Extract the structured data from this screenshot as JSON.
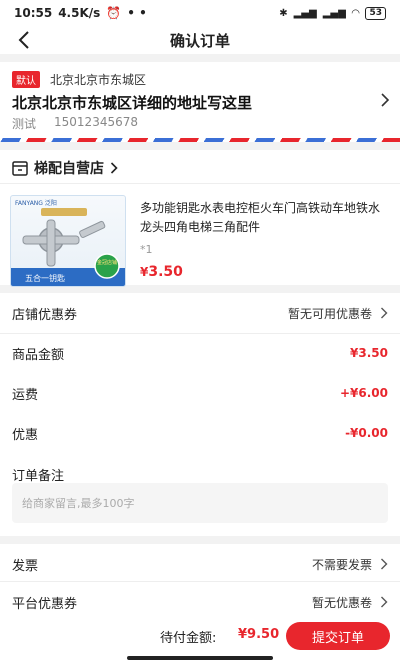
{
  "status": {
    "time": "10:55",
    "speed": "4.5K/s",
    "battery": "53"
  },
  "nav": {
    "title": "确认订单"
  },
  "address": {
    "default_tag": "默认",
    "region": "北京北京市东城区",
    "detail": "北京北京市东城区详细的地址写这里",
    "name": "测试",
    "phone": "15012345678"
  },
  "shop": {
    "name": "梯配自营店",
    "product": {
      "name": "多功能钥匙水表电控柜火车门高铁动车地铁水龙头四角电梯三角配件",
      "qty": "*1",
      "currency": "¥",
      "price": "3.50",
      "img_brand": "FANYANG 泛阳",
      "img_caption": "五合一钥匙",
      "img_badge": "金冠店铺"
    }
  },
  "rows": {
    "coupon": {
      "label": "店铺优惠券",
      "value": "暂无可用优惠卷"
    },
    "amount": {
      "label": "商品金额",
      "value": "¥3.50"
    },
    "shipping": {
      "label": "运费",
      "value": "+¥6.00"
    },
    "discount": {
      "label": "优惠",
      "value": "-¥0.00"
    },
    "remark": {
      "label": "订单备注",
      "placeholder": "给商家留言,最多100字"
    },
    "invoice": {
      "label": "发票",
      "value": "不需要发票"
    },
    "platform": {
      "label": "平台优惠券",
      "value": "暂无优惠卷"
    }
  },
  "footer": {
    "total_label": "待付金额:",
    "total_value": "¥9.50",
    "submit": "提交订单"
  },
  "colors": {
    "accent": "#e8262d",
    "stripe_blue": "#3b6fd6"
  }
}
